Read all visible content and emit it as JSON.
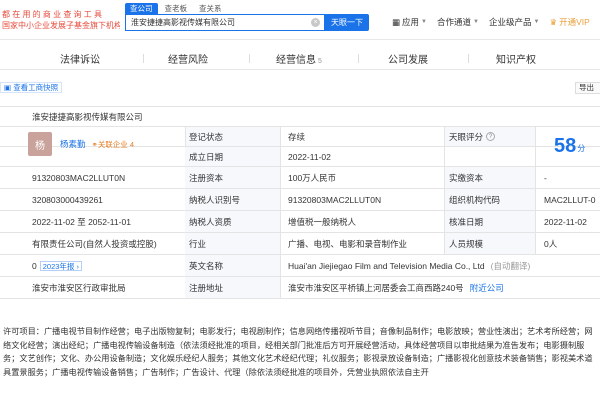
{
  "header": {
    "slogan": [
      "都 在 用 的 商 业 查 询 工 具",
      "国家中小企业发展子基金旗下机构"
    ],
    "search_tabs": [
      "查公司",
      "查老板",
      "查关系"
    ],
    "search_value": "淮安捷捷高影视传媒有限公司",
    "clear_icon": "×",
    "search_button": "天眼一下",
    "nav": [
      "应用",
      "合作通道",
      "企业级产品",
      "开通VIP"
    ]
  },
  "tabs": [
    {
      "label": "法律诉讼",
      "count": ""
    },
    {
      "label": "经营风险",
      "count": ""
    },
    {
      "label": "经营信息",
      "count": "5"
    },
    {
      "label": "公司发展",
      "count": ""
    },
    {
      "label": "知识产权",
      "count": ""
    }
  ],
  "subbar": {
    "report_link": "查看工商快照",
    "guide_button": "导出"
  },
  "company": {
    "name": "淮安捷捷高影视传媒有限公司",
    "logo_char": "杨",
    "legal_person": "杨素勤",
    "related_label": "关联企业 4",
    "reg_status_label": "登记状态",
    "reg_status": "存续",
    "est_date_label": "成立日期",
    "est_date": "2022-11-02",
    "score_label": "天眼评分",
    "score": "58",
    "score_unit": "分",
    "credit_code": "91320803MAC2LLUT0N",
    "reg_capital_label": "注册资本",
    "reg_capital": "100万人民币",
    "paid_capital_label": "实缴资本",
    "paid_capital": "-",
    "reg_no": "320803000439261",
    "taxpayer_id_label": "纳税人识别号",
    "taxpayer_id": "91320803MAC2LLUT0N",
    "org_code_label": "组织机构代码",
    "org_code": "MAC2LLUT-0",
    "term": "2022-11-02 至 2052-11-01",
    "taxpayer_type_label": "纳税人资质",
    "taxpayer_type": "增值税一般纳税人",
    "approved_date_label": "核准日期",
    "approved_date": "2022-11-02",
    "company_type": "有限责任公司(自然人投资或控股)",
    "industry_label": "行业",
    "industry": "广播、电视、电影和录音制作业",
    "staff_label": "人员规模",
    "staff": "0人",
    "insured": "0",
    "annual_report": "2023年报",
    "en_name_label": "英文名称",
    "en_name": "Huai'an Jiejiegao Film and Television Media Co., Ltd",
    "auto_translate": "(自动翻译)",
    "authority": "淮安市淮安区行政审批局",
    "reg_address_label": "注册地址",
    "reg_address": "淮安市淮安区平桥镇上河居委会工商西路240号",
    "nearby_label": "附近公司",
    "scope": "许可项目：广播电视节目制作经营；电子出版物复制；电影发行；电视剧制作；信息网络传播视听节目；音像制品制作；电影放映；营业性演出；艺术考所经营；网络文化经营；演出经纪；广播电视传输设备制造（依法须经批准的项目，经相关部门批准后方可开展经营活动，具体经营项目以审批结果为准告发布；电影摄制服务；文艺创作；文化、办公用设备制造；文化娱乐经纪人服务；其他文化艺术经纪代理；礼仪服务；影视录放设备制造；广播影视化创意技术装备销售；影视美术道具置景服务；广播电视传输设备销售；广告制作；广告设计、代理（除依法须经批准的项目外，凭营业执照依法自主开"
  }
}
